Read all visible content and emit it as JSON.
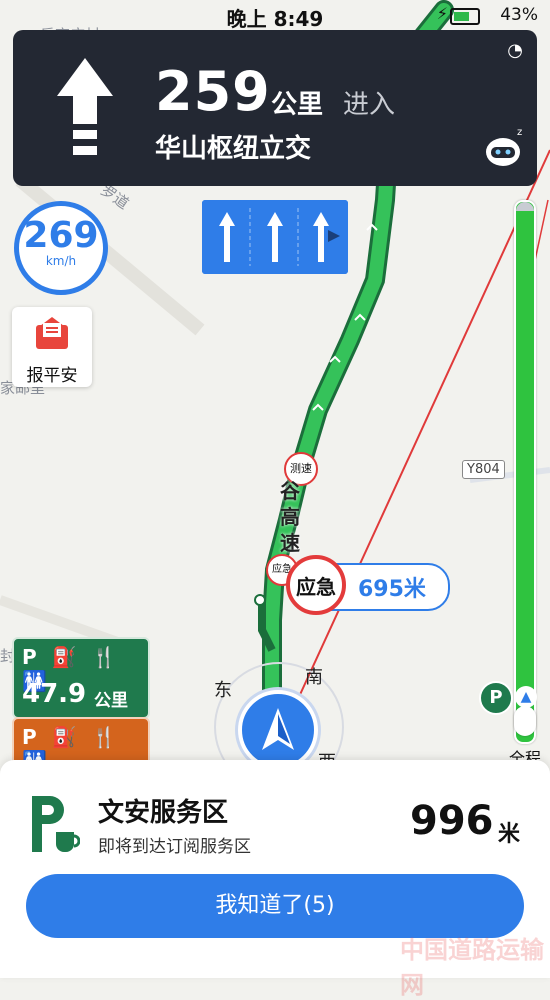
{
  "status": {
    "time": "晚上 8:49",
    "battery": "43%"
  },
  "nav": {
    "distance": "259",
    "unit": "公里",
    "action": "进入",
    "road": "华山枢纽立交"
  },
  "speed": {
    "value": "269",
    "unit": "km/h"
  },
  "safe_report": {
    "label": "报平安"
  },
  "emergency": {
    "label": "应急",
    "distance": "695米"
  },
  "map_signs": {
    "speed_camera": "测速",
    "emergency_small": "应急",
    "road_code": "Y804",
    "highway_chars": [
      "谷",
      "高",
      "速"
    ]
  },
  "compass": {
    "east": "东",
    "south": "南",
    "west": "西"
  },
  "service_cards": [
    {
      "icons": "P ⛽ 🍴 🚻",
      "distance": "47.9",
      "unit": "公里"
    },
    {
      "icons": "P ⛽ 🍴 🚻"
    }
  ],
  "progress": {
    "label": "全程",
    "fraction_remaining": 0.83
  },
  "service_area": {
    "name": "文安服务区",
    "sub": "即将到达订阅服务区",
    "distance": "996",
    "unit": "米"
  },
  "ack_button": "我知道了(5)",
  "watermark": "中国道路运输网",
  "colors": {
    "accent": "#2f7de8",
    "route": "#22a64a",
    "nav_bg": "#232833",
    "emergency": "#e33b3b"
  }
}
